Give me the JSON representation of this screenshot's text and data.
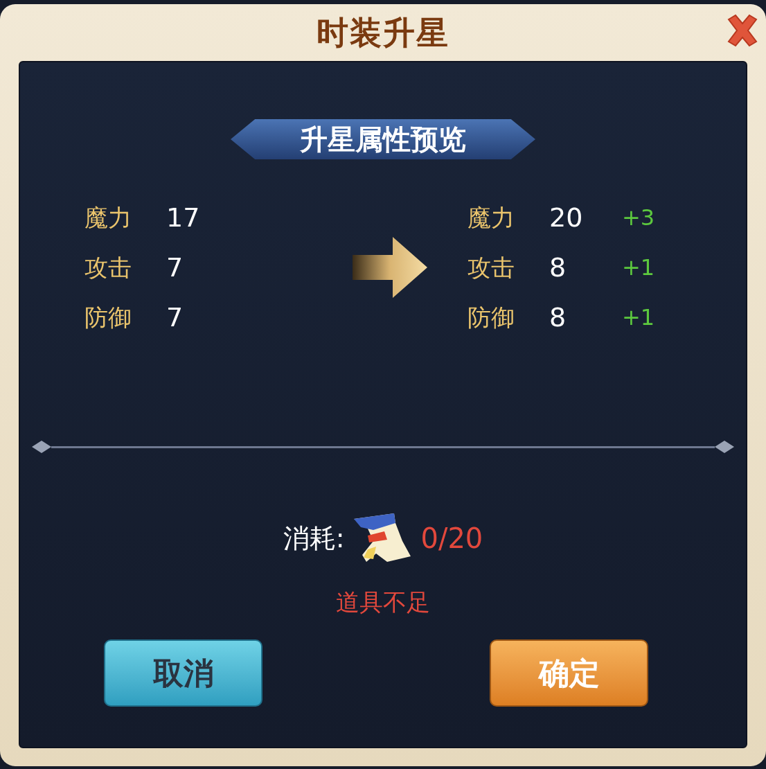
{
  "window": {
    "title": "时装升星"
  },
  "preview": {
    "heading": "升星属性预览",
    "current": [
      {
        "label": "魔力",
        "value": "17"
      },
      {
        "label": "攻击",
        "value": "7"
      },
      {
        "label": "防御",
        "value": "7"
      }
    ],
    "upgraded": [
      {
        "label": "魔力",
        "value": "20",
        "delta": "+3"
      },
      {
        "label": "攻击",
        "value": "8",
        "delta": "+1"
      },
      {
        "label": "防御",
        "value": "8",
        "delta": "+1"
      }
    ]
  },
  "cost": {
    "label": "消耗:",
    "amount": "0/20",
    "sufficient": false
  },
  "warning": "道具不足",
  "buttons": [
    {
      "label": "取消",
      "kind": "cancel"
    },
    {
      "label": "确定",
      "kind": "confirm"
    }
  ]
}
